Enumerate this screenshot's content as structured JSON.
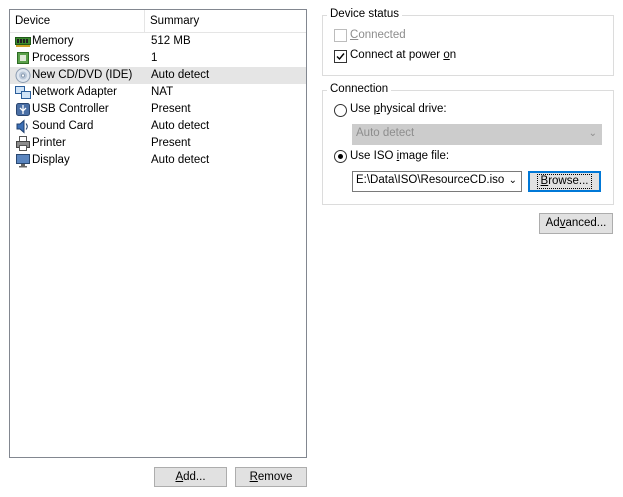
{
  "device_list": {
    "headers": {
      "device": "Device",
      "summary": "Summary"
    },
    "rows": [
      {
        "icon": "memory-icon",
        "device": "Memory",
        "summary": "512 MB",
        "selected": false
      },
      {
        "icon": "processor-icon",
        "device": "Processors",
        "summary": "1",
        "selected": false
      },
      {
        "icon": "cd-dvd-icon",
        "device": "New CD/DVD (IDE)",
        "summary": "Auto detect",
        "selected": true
      },
      {
        "icon": "network-adapter-icon",
        "device": "Network Adapter",
        "summary": "NAT",
        "selected": false
      },
      {
        "icon": "usb-icon",
        "device": "USB Controller",
        "summary": "Present",
        "selected": false
      },
      {
        "icon": "sound-card-icon",
        "device": "Sound Card",
        "summary": "Auto detect",
        "selected": false
      },
      {
        "icon": "printer-icon",
        "device": "Printer",
        "summary": "Present",
        "selected": false
      },
      {
        "icon": "display-icon",
        "device": "Display",
        "summary": "Auto detect",
        "selected": false
      }
    ]
  },
  "buttons": {
    "add": {
      "pre": "",
      "key": "A",
      "post": "dd..."
    },
    "remove": {
      "pre": "",
      "key": "R",
      "post": "emove"
    },
    "browse": {
      "pre": "",
      "key": "B",
      "post": "rowse..."
    },
    "advanced": {
      "pre": "Ad",
      "key": "v",
      "post": "anced..."
    }
  },
  "device_status": {
    "title": "Device status",
    "connected": {
      "pre": "",
      "key": "C",
      "post": "onnected",
      "checked": false,
      "enabled": false
    },
    "connect_at_power_on": {
      "pre": "Connect at power ",
      "key": "o",
      "post": "n",
      "checked": true,
      "enabled": true
    }
  },
  "connection": {
    "title": "Connection",
    "physical_drive": {
      "pre": "Use ",
      "key": "p",
      "post": "hysical drive:",
      "selected": false
    },
    "physical_drive_value": "Auto detect",
    "iso": {
      "pre": "Use ISO ",
      "key": "i",
      "post": "mage file:",
      "selected": true
    },
    "iso_path": "E:\\Data\\ISO\\ResourceCD.iso"
  },
  "colors": {
    "selection": "#e5e5e5",
    "focus_border": "#0078d7",
    "disabled_text": "#8d8d8d"
  }
}
